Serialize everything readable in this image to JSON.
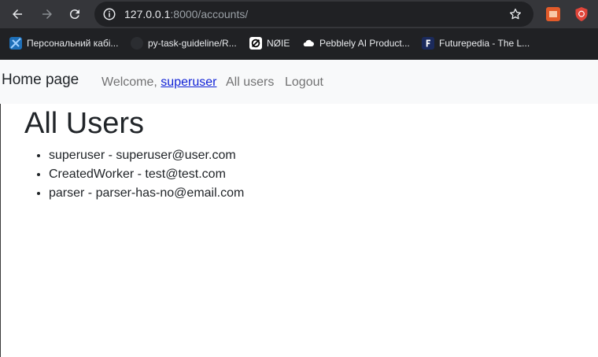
{
  "browser": {
    "url_host": "127.0.0.1",
    "url_rest": ":8000/accounts/",
    "bookmarks": [
      {
        "label": "Персональний кабі..."
      },
      {
        "label": "py-task-guideline/R..."
      },
      {
        "label": "NØIE"
      },
      {
        "label": "Pebblely AI Product..."
      },
      {
        "label": "Futurepedia - The L..."
      }
    ]
  },
  "navbar": {
    "brand": "Home page",
    "welcome_prefix": "Welcome,",
    "username": "superuser",
    "all_users": "All users",
    "logout": "Logout"
  },
  "main": {
    "title": "All Users",
    "users": [
      "superuser - superuser@user.com",
      "CreatedWorker - test@test.com",
      "parser - parser-has-no@email.com"
    ]
  },
  "colors": {
    "chrome_bg": "#202124",
    "toolbar_bg": "#35363a",
    "navbar_bg": "#f8f9fa",
    "link": "#0d1fd6"
  }
}
